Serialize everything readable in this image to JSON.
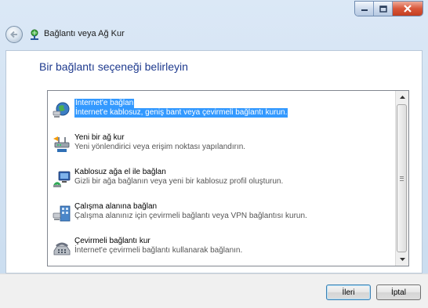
{
  "window": {
    "title": "Bağlantı veya Ağ Kur",
    "controls": {
      "minimize": "minimize-icon",
      "maximize": "maximize-icon",
      "close": "close-icon"
    }
  },
  "content": {
    "heading": "Bir bağlantı seçeneği belirleyin"
  },
  "options": [
    {
      "title": "İnternet'e bağlan",
      "description": "İnternet'e kablosuz, geniş bant veya çevirmeli bağlantı kurun.",
      "icon": "globe-network-icon",
      "selected": true
    },
    {
      "title": "Yeni bir ağ kur",
      "description": "Yeni yönlendirici veya erişim noktası yapılandırın.",
      "icon": "router-icon",
      "selected": false
    },
    {
      "title": "Kablosuz ağa el ile bağlan",
      "description": "Gizli bir ağa bağlanın veya yeni bir kablosuz profil oluşturun.",
      "icon": "wireless-computer-icon",
      "selected": false
    },
    {
      "title": "Çalışma alanına bağlan",
      "description": "Çalışma alanınız için çevirmeli bağlantı veya VPN bağlantısı kurun.",
      "icon": "workplace-building-icon",
      "selected": false
    },
    {
      "title": "Çevirmeli bağlantı kur",
      "description": "İnternet'e çevirmeli bağlantı kullanarak bağlanın.",
      "icon": "phone-modem-icon",
      "selected": false
    }
  ],
  "footer": {
    "next_label": "İleri",
    "cancel_label": "İptal"
  },
  "colors": {
    "heading": "#1e3a8e",
    "selection": "#3399ff",
    "close_button": "#c94a2c"
  }
}
